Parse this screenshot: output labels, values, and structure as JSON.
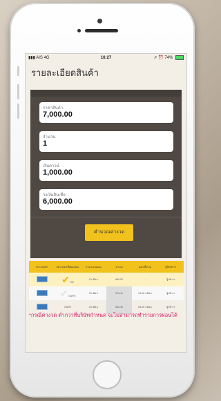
{
  "status_bar": {
    "carrier": "AIS 4G",
    "time": "16:27",
    "battery": "74%"
  },
  "page": {
    "title": "รายละเอียดสินค้า"
  },
  "form": {
    "fields": [
      {
        "label": "ราคาสินค้า",
        "value": "7,000.00"
      },
      {
        "label": "จำนวน",
        "value": "1"
      },
      {
        "label": "เงินดาวน์",
        "value": "1,000.00"
      },
      {
        "label": "วงเงินสินเชื่อ",
        "value": "6,000.00"
      }
    ],
    "calc_button": "คำนวณค่างวด"
  },
  "table": {
    "headers": [
      "ประเภทบัตร",
      "อัตราดอกเบี้ยต่อเดือน",
      "จำนวนงวดผ่อน",
      "ค่างวด",
      "ดอกเบี้ยรวม",
      "ผู้ให้บริการ"
    ],
    "rows": [
      {
        "rate": "0%",
        "term": "10 เดือน",
        "installment": "600.00",
        "interest": "-",
        "provider": "ผู้บริการ",
        "selected": true
      },
      {
        "rate": "0.69%",
        "term": "10 เดือน",
        "installment": "674.11",
        "interest": "41.40 / เดือน",
        "provider": "ผู้บริการ",
        "selected": false
      },
      {
        "rate": "0.89%",
        "term": "10 เดือน",
        "installment": "653.40",
        "interest": "53.40 / เดือน",
        "provider": "ผู้บริการ",
        "selected": false
      }
    ]
  },
  "note": "*กรณีค่างวด ต่ำกว่าที่บริษัทกำหนด จะไม่สามารถทำรายการผ่อนได้",
  "colors": {
    "accent": "#f2c21c",
    "panel": "#4f4843",
    "note": "#d81b60",
    "bank_icon": "#3a7bbf"
  },
  "icons": [
    "signal-icon",
    "location-icon",
    "alarm-icon",
    "battery-icon",
    "bank-card-icon",
    "check-icon"
  ]
}
